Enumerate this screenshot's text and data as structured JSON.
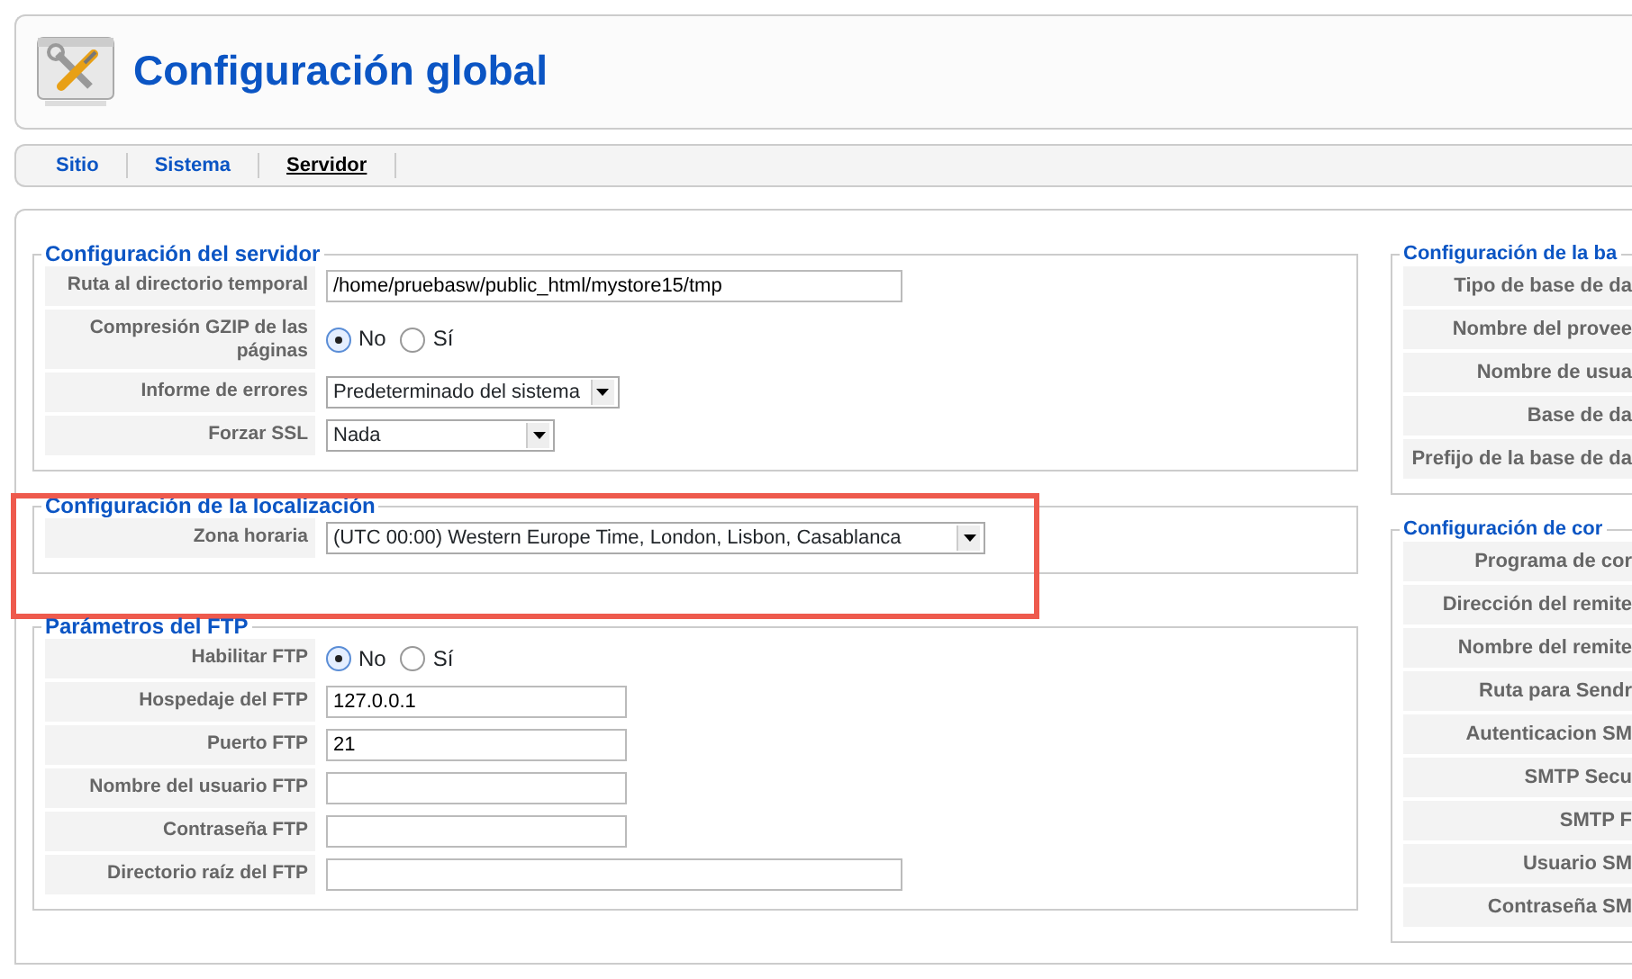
{
  "header": {
    "title": "Configuración global"
  },
  "tabs": [
    {
      "label": "Sitio",
      "selected": false
    },
    {
      "label": "Sistema",
      "selected": false
    },
    {
      "label": "Servidor",
      "selected": true
    }
  ],
  "left_sections": [
    {
      "title": "Configuración del servidor",
      "highlighted": false,
      "fields": [
        {
          "kind": "path",
          "label": "Ruta al directorio temporal",
          "value": "/home/pruebasw/public_html/mystore15/tmp"
        },
        {
          "kind": "radio",
          "label": "Compresión GZIP de las páginas",
          "options": [
            {
              "label": "No",
              "selected": true
            },
            {
              "label": "Sí",
              "selected": false
            }
          ]
        },
        {
          "kind": "select",
          "label": "Informe de errores",
          "value": "Predeterminado del sistema"
        },
        {
          "kind": "select-fixed",
          "label": "Forzar SSL",
          "value": "Nada"
        }
      ]
    },
    {
      "title": "Configuración de la localización",
      "highlighted": true,
      "fields": [
        {
          "kind": "select-wide",
          "label": "Zona horaria",
          "value": "(UTC 00:00) Western Europe Time, London, Lisbon, Casablanca"
        }
      ]
    },
    {
      "title": "Parámetros del FTP",
      "highlighted": false,
      "fields": [
        {
          "kind": "radio",
          "label": "Habilitar FTP",
          "options": [
            {
              "label": "No",
              "selected": true
            },
            {
              "label": "Sí",
              "selected": false
            }
          ]
        },
        {
          "kind": "text",
          "label": "Hospedaje del FTP",
          "value": "127.0.0.1"
        },
        {
          "kind": "text",
          "label": "Puerto FTP",
          "value": "21"
        },
        {
          "kind": "text",
          "label": "Nombre del usuario FTP"
        },
        {
          "kind": "text",
          "label": "Contraseña FTP"
        },
        {
          "kind": "path",
          "label": "Directorio raíz del FTP"
        }
      ]
    }
  ],
  "right_sections": [
    {
      "title": "Configuración de la ba",
      "labels": [
        "Tipo de base de da",
        "Nombre del provee",
        "Nombre de usua",
        "Base de da",
        "Prefijo de la base de da"
      ]
    },
    {
      "title": "Configuración de cor",
      "labels": [
        "Programa de cor",
        "Dirección del remite",
        "Nombre del remite",
        "Ruta para Sendr",
        "Autenticacion SM",
        "SMTP Secu",
        "SMTP F",
        "Usuario SM",
        "Contraseña SM"
      ]
    }
  ]
}
